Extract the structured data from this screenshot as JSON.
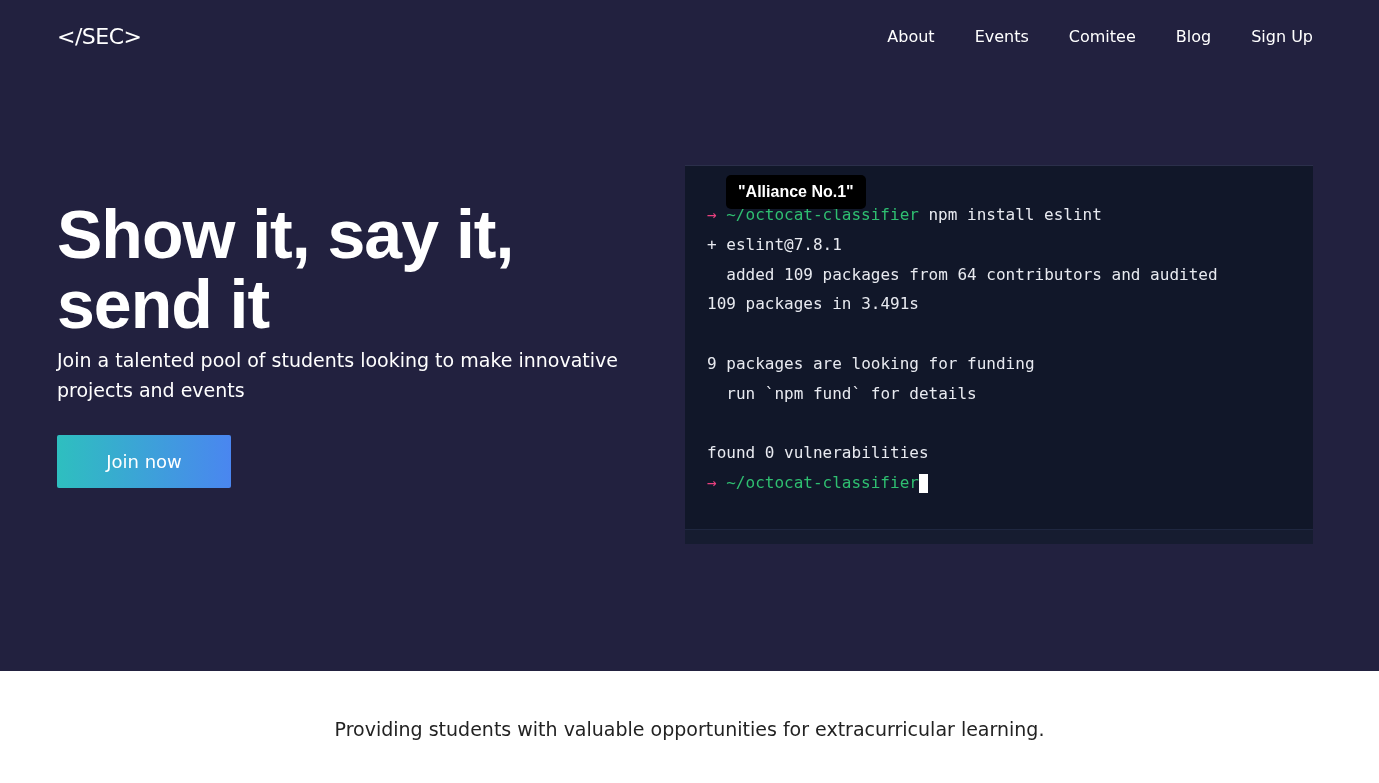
{
  "nav": {
    "logo": "</SEC>",
    "links": [
      "About",
      "Events",
      "Comitee",
      "Blog",
      "Sign Up"
    ]
  },
  "hero": {
    "headline": "Show it, say it, send it",
    "subtitle": "Join a talented pool of students looking to make innovative projects and events",
    "button": "Join now"
  },
  "terminal": {
    "tooltip": "\"Alliance No.1\"",
    "blocks": [
      {
        "lines": [
          {
            "segments": [
              {
                "kind": "arrow",
                "text": "→"
              },
              {
                "kind": "path",
                "text": "~/octocat-classifier"
              },
              {
                "kind": "plain",
                "text": "npm install eslint"
              }
            ]
          },
          {
            "segments": [
              {
                "kind": "plain",
                "text": "+ eslint@7.8.1"
              }
            ]
          },
          {
            "segments": [
              {
                "kind": "plain",
                "text": "  added 109 packages from 64 contributors and audited"
              }
            ]
          },
          {
            "segments": [
              {
                "kind": "plain",
                "text": "109 packages in 3.491s"
              }
            ]
          }
        ]
      },
      {
        "lines": [
          {
            "segments": [
              {
                "kind": "plain",
                "text": "9 packages are looking for funding"
              }
            ]
          },
          {
            "segments": [
              {
                "kind": "plain",
                "text": "  run `npm fund` for details"
              }
            ]
          }
        ]
      },
      {
        "lines": [
          {
            "segments": [
              {
                "kind": "plain",
                "text": "found 0 vulnerabilities"
              }
            ]
          },
          {
            "segments": [
              {
                "kind": "arrow",
                "text": "→"
              },
              {
                "kind": "path",
                "text": "~/octocat-classifier"
              }
            ],
            "cursor": true
          }
        ]
      }
    ]
  },
  "tagline": "Providing students with valuable opportunities for extracurricular learning."
}
